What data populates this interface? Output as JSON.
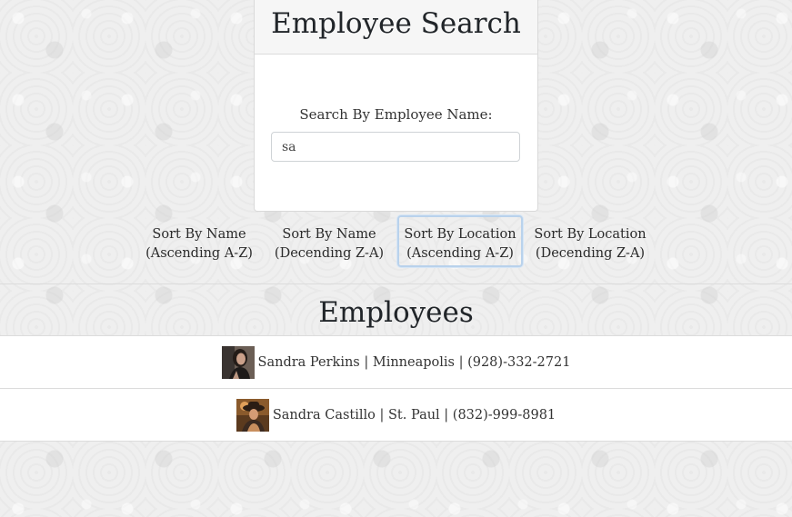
{
  "search": {
    "title": "Employee Search",
    "label": "Search By Employee Name:",
    "value": "sa"
  },
  "sort_buttons": [
    {
      "line1": "Sort By Name",
      "line2": "(Ascending A-Z)"
    },
    {
      "line1": "Sort By Name",
      "line2": "(Decending Z-A)"
    },
    {
      "line1": "Sort By Location",
      "line2": "(Ascending A-Z)",
      "active": true
    },
    {
      "line1": "Sort By Location",
      "line2": "(Decending Z-A)"
    }
  ],
  "employees": {
    "title": "Employees",
    "rows": [
      {
        "text": "Sandra Perkins | Minneapolis | (928)-332-2721",
        "avatar": "woman-portrait-avatar"
      },
      {
        "text": "Sandra Castillo | St. Paul | (832)-999-8981",
        "avatar": "woman-hat-portrait-avatar"
      }
    ]
  }
}
